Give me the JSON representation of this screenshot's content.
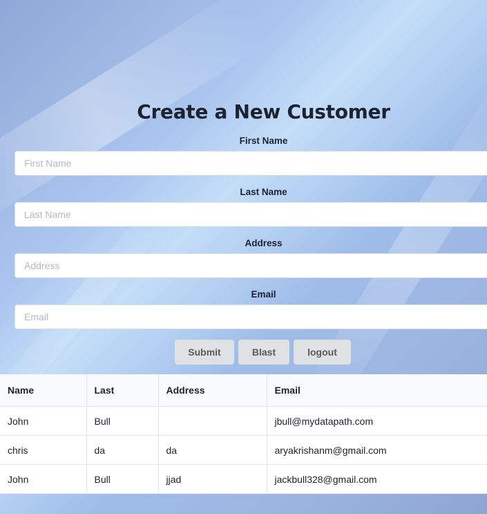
{
  "form": {
    "title": "Create a New Customer",
    "fields": [
      {
        "label": "First Name",
        "placeholder": "First Name",
        "value": ""
      },
      {
        "label": "Last Name",
        "placeholder": "Last Name",
        "value": ""
      },
      {
        "label": "Address",
        "placeholder": "Address",
        "value": ""
      },
      {
        "label": "Email",
        "placeholder": "Email",
        "value": ""
      }
    ],
    "buttons": {
      "submit": "Submit",
      "blast": "Blast",
      "logout": "logout"
    }
  },
  "table": {
    "columns": [
      "Name",
      "Last",
      "Address",
      "Email"
    ],
    "rows": [
      [
        "John",
        "Bull",
        "",
        "jbull@mydatapath.com"
      ],
      [
        "chris",
        "da",
        "da",
        "aryakrishanm@gmail.com"
      ],
      [
        "John",
        "Bull",
        "jjad",
        "jackbull328@gmail.com"
      ]
    ]
  }
}
